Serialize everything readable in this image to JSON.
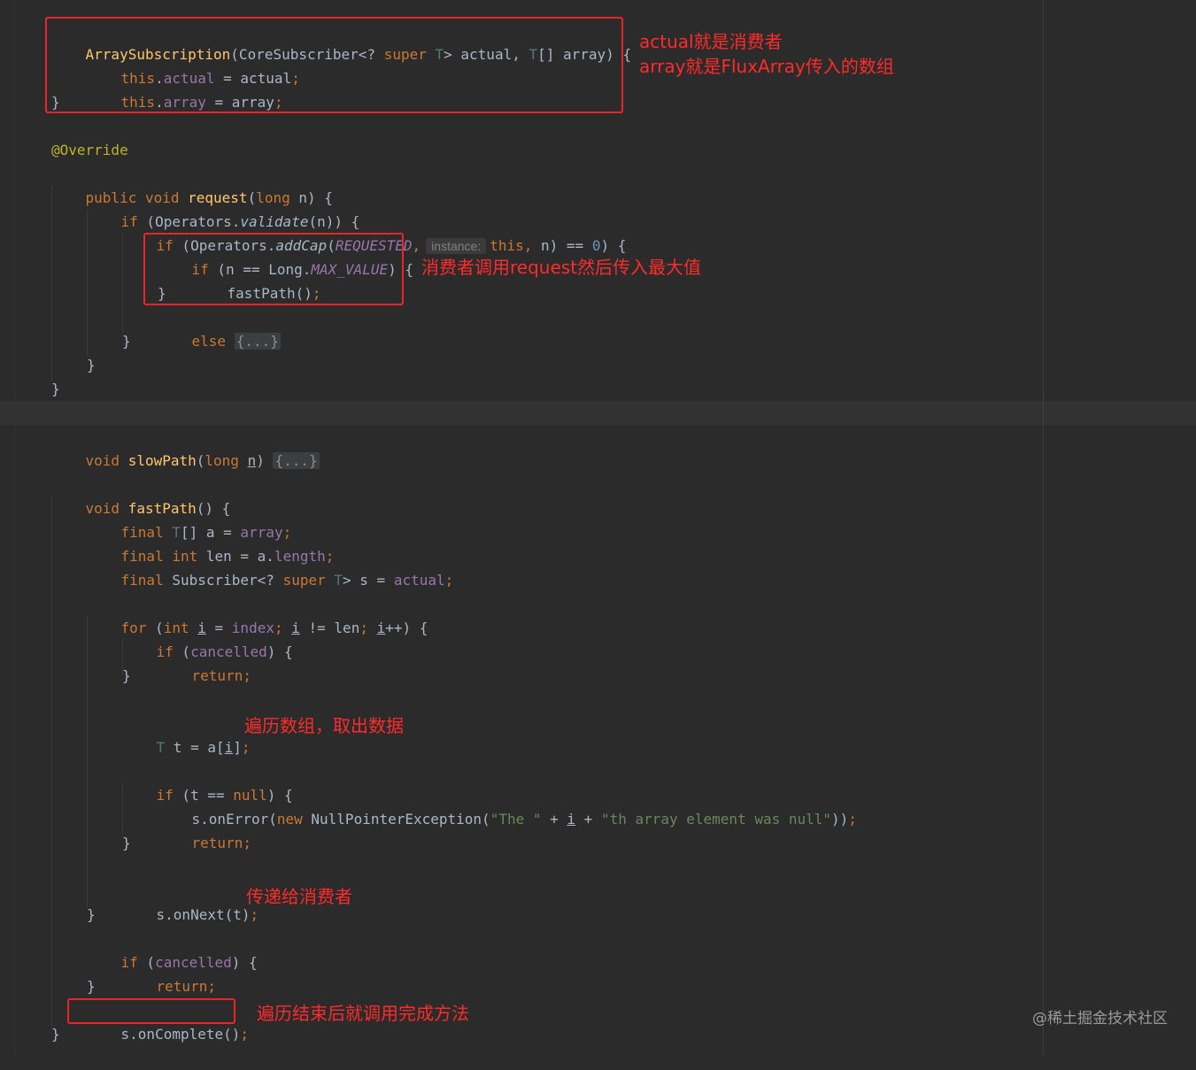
{
  "code": {
    "l1": {
      "ctor": "ArraySubscription",
      "a": "(CoreSubscriber<? ",
      "super": "super",
      "b": " ",
      "T": "T",
      "c": "> actual, ",
      "T2": "T",
      "d": "[] array) {"
    },
    "l2": {
      "this": "this",
      "dot": ".",
      "field": "actual",
      "rest": " = actual",
      "semi": ";"
    },
    "l3": {
      "this": "this",
      "dot": ".",
      "field": "array",
      "rest": " = array",
      "semi": ";"
    },
    "l4": "}",
    "l6": "@Override",
    "l7": {
      "kw": "public void ",
      "fn": "request",
      "a": "(",
      "long": "long",
      "b": " n) {"
    },
    "l8": {
      "if": "if",
      "a": " (Operators.",
      "validate": "validate",
      "b": "(n)) {"
    },
    "l9": {
      "if": "if",
      "a": " (Operators.",
      "addCap": "addCap",
      "b": "(",
      "REQUESTED": "REQUESTED",
      "comma": ",",
      "hint": "instance:",
      "this": "this",
      "comma2": ",",
      "c": " n) == ",
      "zero": "0",
      "d": ") {"
    },
    "l10": {
      "if": "if",
      "a": " (n == Long.",
      "max": "MAX_VALUE",
      "b": ") {"
    },
    "l11": {
      "a": "fastPath()",
      "semi": ";"
    },
    "l12": "}",
    "l13": {
      "else": "else",
      "fold": "{...}"
    },
    "l14": "}",
    "l15": "}",
    "l16": "}",
    "l18": {
      "kw": "void ",
      "fn": "slowPath",
      "a": "(",
      "long": "long",
      "b": " ",
      "n": "n",
      "c": ") ",
      "fold": "{...}"
    },
    "l20": {
      "kw": "void ",
      "fn": "fastPath",
      "a": "() {"
    },
    "l21": {
      "final": "final",
      "b": " ",
      "T": "T",
      "c": "[] a = ",
      "array": "array",
      "semi": ";"
    },
    "l22": {
      "final": "final int",
      "b": " len = a.",
      "length": "length",
      "semi": ";"
    },
    "l23": {
      "final": "final",
      "b": " Subscriber<? ",
      "super": "super",
      "c": " ",
      "T": "T",
      "d": "> s = ",
      "actual": "actual",
      "semi": ";"
    },
    "l25": {
      "for": "for",
      "a": " (",
      "int": "int",
      "b": " ",
      "i1": "i",
      "c": " = ",
      "index": "index",
      "semi1": ";",
      "d": " ",
      "i2": "i",
      "e": " != len",
      "semi2": ";",
      "f": " ",
      "i3": "i",
      "g": "++) {"
    },
    "l26": {
      "if": "if",
      "a": " (",
      "cancelled": "cancelled",
      "b": ") {"
    },
    "l27": {
      "ret": "return",
      "semi": ";"
    },
    "l28": "}",
    "l30": {
      "T": "T",
      "a": " t = a[",
      "i": "i",
      "b": "]",
      "semi": ";"
    },
    "l32": {
      "if": "if",
      "a": " (t == ",
      "null": "null",
      "b": ") {"
    },
    "l33": {
      "a": "s.onError(",
      "new": "new",
      "b": " NullPointerException(",
      "s1": "\"The \"",
      "c": " + ",
      "i": "i",
      "d": " + ",
      "s2": "\"th array element was null\"",
      "e": "))",
      "semi": ";"
    },
    "l34": {
      "ret": "return",
      "semi": ";"
    },
    "l35": "}",
    "l37": {
      "a": "s.onNext(t)",
      "semi": ";"
    },
    "l38": "}",
    "l39": {
      "if": "if",
      "a": " (",
      "cancelled": "cancelled",
      "b": ") {"
    },
    "l40": {
      "ret": "return",
      "semi": ";"
    },
    "l41": "}",
    "l42": {
      "a": "s.onComplete()",
      "semi": ";"
    },
    "l43": "}"
  },
  "annotations": {
    "constructor_note_line1": "actual就是消费者",
    "constructor_note_line2": "array就是FluxArray传入的数组",
    "request_note": "消费者调用request然后传入最大值",
    "loop_note": "遍历数组，取出数据",
    "onnext_note": "传递给消费者",
    "complete_note": "遍历结束后就调用完成方法"
  },
  "watermark": "@稀土掘金技术社区",
  "colors": {
    "background": "#2b2b2b",
    "keyword": "#cc7832",
    "method": "#ffc66d",
    "field": "#9876aa",
    "annotation_box": "#e8262a"
  }
}
